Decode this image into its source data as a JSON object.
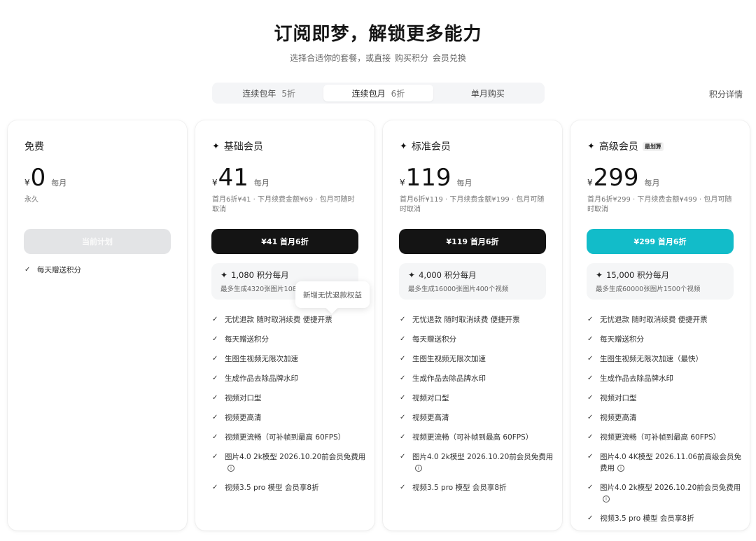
{
  "header": {
    "title": "订阅即梦，解锁更多能力",
    "subtitle_prefix": "选择合适你的套餐，或直接",
    "subtitle_buy": "购买积分",
    "subtitle_redeem": "会员兑换"
  },
  "tabs": [
    {
      "label": "连续包年",
      "discount": "5折",
      "active": false
    },
    {
      "label": "连续包月",
      "discount": "6折",
      "active": true
    },
    {
      "label": "单月购买",
      "discount": "",
      "active": false
    }
  ],
  "points_details_link": "积分详情",
  "tooltip": "新增无忧退款权益",
  "plans": {
    "free": {
      "name": "免费",
      "currency": "¥",
      "price": "0",
      "period": "每月",
      "note": "永久",
      "cta": "当前计划",
      "features": [
        "每天赠送积分"
      ]
    },
    "basic": {
      "name": "基础会员",
      "icon": "sparkle-icon",
      "currency": "¥",
      "price": "41",
      "period": "每月",
      "note": "首月6折¥41 · 下月续费金额¥69 · 包月可随时取消",
      "cta": "¥41 首月6折",
      "points": "1,080 积分每月",
      "generate": "最多生成4320张图片108个视频",
      "features": [
        "无忧退款 随时取消续费 便捷开票",
        "每天赠送积分",
        "生图生视频无限次加速",
        "生成作品去除品牌水印",
        "视频对口型",
        "视频更高清",
        "视频更流畅（可补帧到最高 60FPS）",
        "图片4.0 2k模型 2026.10.20前会员免费用",
        "视频3.5 pro 模型 会员享8折"
      ]
    },
    "standard": {
      "name": "标准会员",
      "icon": "sparkle-icon",
      "currency": "¥",
      "price": "119",
      "period": "每月",
      "note": "首月6折¥119 · 下月续费金额¥199 · 包月可随时取消",
      "cta": "¥119 首月6折",
      "points": "4,000 积分每月",
      "generate": "最多生成16000张图片400个视频",
      "features": [
        "无忧退款 随时取消续费 便捷开票",
        "每天赠送积分",
        "生图生视频无限次加速",
        "生成作品去除品牌水印",
        "视频对口型",
        "视频更高清",
        "视频更流畅（可补帧到最高 60FPS）",
        "图片4.0 2k模型 2026.10.20前会员免费用",
        "视频3.5 pro 模型 会员享8折"
      ]
    },
    "premium": {
      "name": "高级会员",
      "badge": "最划算",
      "icon": "sparkle-icon",
      "currency": "¥",
      "price": "299",
      "period": "每月",
      "note": "首月6折¥299 · 下月续费金额¥499 · 包月可随时取消",
      "cta": "¥299 首月6折",
      "points": "15,000 积分每月",
      "generate": "最多生成60000张图片1500个视频",
      "features": [
        "无忧退款 随时取消续费 便捷开票",
        "每天赠送积分",
        "生图生视频无限次加速（最快）",
        "生成作品去除品牌水印",
        "视频对口型",
        "视频更高清",
        "视频更流畅（可补帧到最高 60FPS）",
        "图片4.0 4K模型 2026.11.06前高级会员免费用",
        "图片4.0 2k模型 2026.10.20前会员免费用",
        "视频3.5 pro 模型 会员享8折"
      ]
    }
  },
  "colors": {
    "accent_teal": "#12bcc9",
    "dark_button": "#141414",
    "disabled_button": "#e3e4e6"
  }
}
